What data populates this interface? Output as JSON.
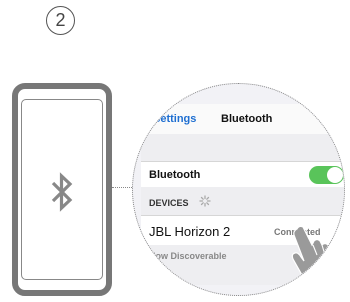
{
  "step": {
    "number": "2"
  },
  "icons": {
    "phone": "smartphone-icon",
    "bluetooth": "bluetooth-icon",
    "spinner": "loading-spinner-icon",
    "hand": "pointing-hand-icon",
    "info": "info-icon"
  },
  "colors": {
    "toggle_on": "#59c45a",
    "link_blue": "#1f6fd1",
    "phone_outline": "#777777"
  },
  "screen": {
    "back_label": "Settings",
    "title": "Bluetooth",
    "bluetooth_toggle_label": "Bluetooth",
    "bluetooth_enabled": true,
    "devices_header": "DEVICES",
    "device": {
      "name": "JBL Horizon 2",
      "status": "Connected",
      "info_glyph": "i"
    },
    "discoverable_text": "Now Discoverable"
  }
}
